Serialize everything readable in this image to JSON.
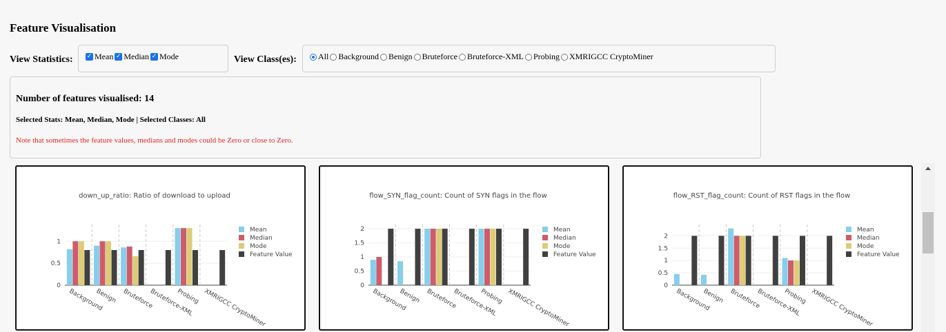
{
  "title": "Feature Visualisation",
  "view_statistics": {
    "label": "View Statistics:",
    "options": [
      {
        "label": "Mean",
        "checked": true
      },
      {
        "label": "Median",
        "checked": true
      },
      {
        "label": "Mode",
        "checked": true
      }
    ]
  },
  "view_classes": {
    "label": "View Class(es):",
    "options": [
      {
        "label": "All",
        "selected": true
      },
      {
        "label": "Background",
        "selected": false
      },
      {
        "label": "Benign",
        "selected": false
      },
      {
        "label": "Bruteforce",
        "selected": false
      },
      {
        "label": "Bruteforce-XML",
        "selected": false
      },
      {
        "label": "Probing",
        "selected": false
      },
      {
        "label": "XMRIGCC CryptoMiner",
        "selected": false
      }
    ]
  },
  "info": {
    "features_count": "Number of features visualised: 14",
    "selected": "Selected Stats: Mean, Median, Mode | Selected Classes: All",
    "note": "Note that sometimes the feature values, medians and modes could be Zero or close to Zero."
  },
  "colors": {
    "mean": "#87ceeb",
    "median": "#cd5c6c",
    "mode": "#ddcc77",
    "feature": "#404040",
    "warning": "#e8231f"
  },
  "chart_data": [
    {
      "type": "bar",
      "title": "down_up_ratio: Ratio of download to upload",
      "categories": [
        "Background",
        "Benign",
        "Bruteforce",
        "Bruteforce-XML",
        "Probing",
        "XMRIGCC CryptoMiner"
      ],
      "ylim": [
        0,
        1.35
      ],
      "yticks": [
        0,
        0.5,
        1
      ],
      "series": [
        {
          "name": "Mean",
          "values": [
            0.82,
            0.9,
            0.86,
            null,
            1.3,
            null
          ]
        },
        {
          "name": "Median",
          "values": [
            1.0,
            1.0,
            0.88,
            null,
            1.3,
            null
          ]
        },
        {
          "name": "Mode",
          "values": [
            1.0,
            1.0,
            0.66,
            null,
            1.3,
            null
          ]
        },
        {
          "name": "Feature Value",
          "values": [
            0.8,
            0.8,
            0.8,
            0.8,
            0.8,
            0.8
          ]
        }
      ]
    },
    {
      "type": "bar",
      "title": "flow_SYN_flag_count: Count of SYN flags in the flow",
      "categories": [
        "Background",
        "Benign",
        "Bruteforce",
        "Bruteforce-XML",
        "Probing",
        "XMRIGCC CryptoMiner"
      ],
      "ylim": [
        0,
        2.1
      ],
      "yticks": [
        0,
        0.5,
        1,
        1.5,
        2
      ],
      "series": [
        {
          "name": "Mean",
          "values": [
            0.9,
            0.85,
            2.0,
            null,
            2.0,
            null
          ]
        },
        {
          "name": "Median",
          "values": [
            1.0,
            null,
            2.0,
            null,
            2.0,
            null
          ]
        },
        {
          "name": "Mode",
          "values": [
            null,
            null,
            2.0,
            null,
            2.0,
            null
          ]
        },
        {
          "name": "Feature Value",
          "values": [
            2,
            2,
            2,
            2,
            2,
            2
          ]
        }
      ]
    },
    {
      "type": "bar",
      "title": "flow_RST_flag_count: Count of RST flags in the flow",
      "categories": [
        "Background",
        "Benign",
        "Bruteforce",
        "Bruteforce-XML",
        "Probing",
        "XMRIGCC CryptoMiner"
      ],
      "ylim": [
        0,
        2.4
      ],
      "yticks": [
        0,
        0.5,
        1,
        1.5,
        2
      ],
      "series": [
        {
          "name": "Mean",
          "values": [
            0.45,
            0.42,
            2.3,
            null,
            1.1,
            null
          ]
        },
        {
          "name": "Median",
          "values": [
            null,
            null,
            2.0,
            null,
            1.0,
            null
          ]
        },
        {
          "name": "Mode",
          "values": [
            null,
            null,
            2.0,
            null,
            1.0,
            null
          ]
        },
        {
          "name": "Feature Value",
          "values": [
            2,
            2,
            2,
            2,
            2,
            2
          ]
        }
      ]
    }
  ]
}
